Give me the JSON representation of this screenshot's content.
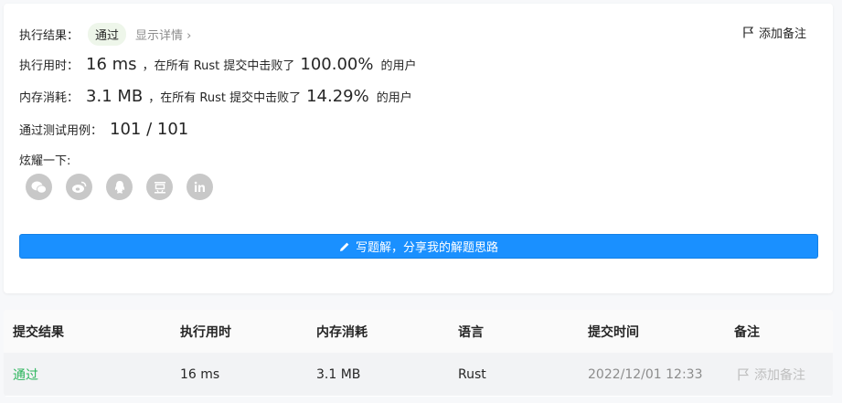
{
  "summary": {
    "result_label": "执行结果：",
    "result_value": "通过",
    "detail_link": "显示详情 ›",
    "add_note": "添加备注",
    "runtime": {
      "label": "执行用时：",
      "value": "16 ms",
      "mid": "，在所有 Rust 提交中击败了",
      "percent": "100.00%",
      "suffix": "的用户"
    },
    "memory": {
      "label": "内存消耗：",
      "value": "3.1 MB",
      "mid": "，在所有 Rust 提交中击败了",
      "percent": "14.29%",
      "suffix": "的用户"
    },
    "tests": {
      "label": "通过测试用例：",
      "value": "101 / 101"
    },
    "share_label": "炫耀一下:",
    "share_icons": [
      "wechat-icon",
      "weibo-icon",
      "qq-icon",
      "douban-icon",
      "linkedin-icon"
    ],
    "write_button": "写题解，分享我的解题思路"
  },
  "table": {
    "headers": [
      "提交结果",
      "执行用时",
      "内存消耗",
      "语言",
      "提交时间",
      "备注"
    ],
    "rows": [
      {
        "result": "通过",
        "runtime": "16 ms",
        "memory": "3.1 MB",
        "language": "Rust",
        "time": "2022/12/01 12:33",
        "note": "添加备注"
      }
    ]
  },
  "colors": {
    "accent": "#1a90ff",
    "pass": "#2db55d",
    "pill_bg": "#eef6ea",
    "icon_grey": "#c8c8c8"
  }
}
